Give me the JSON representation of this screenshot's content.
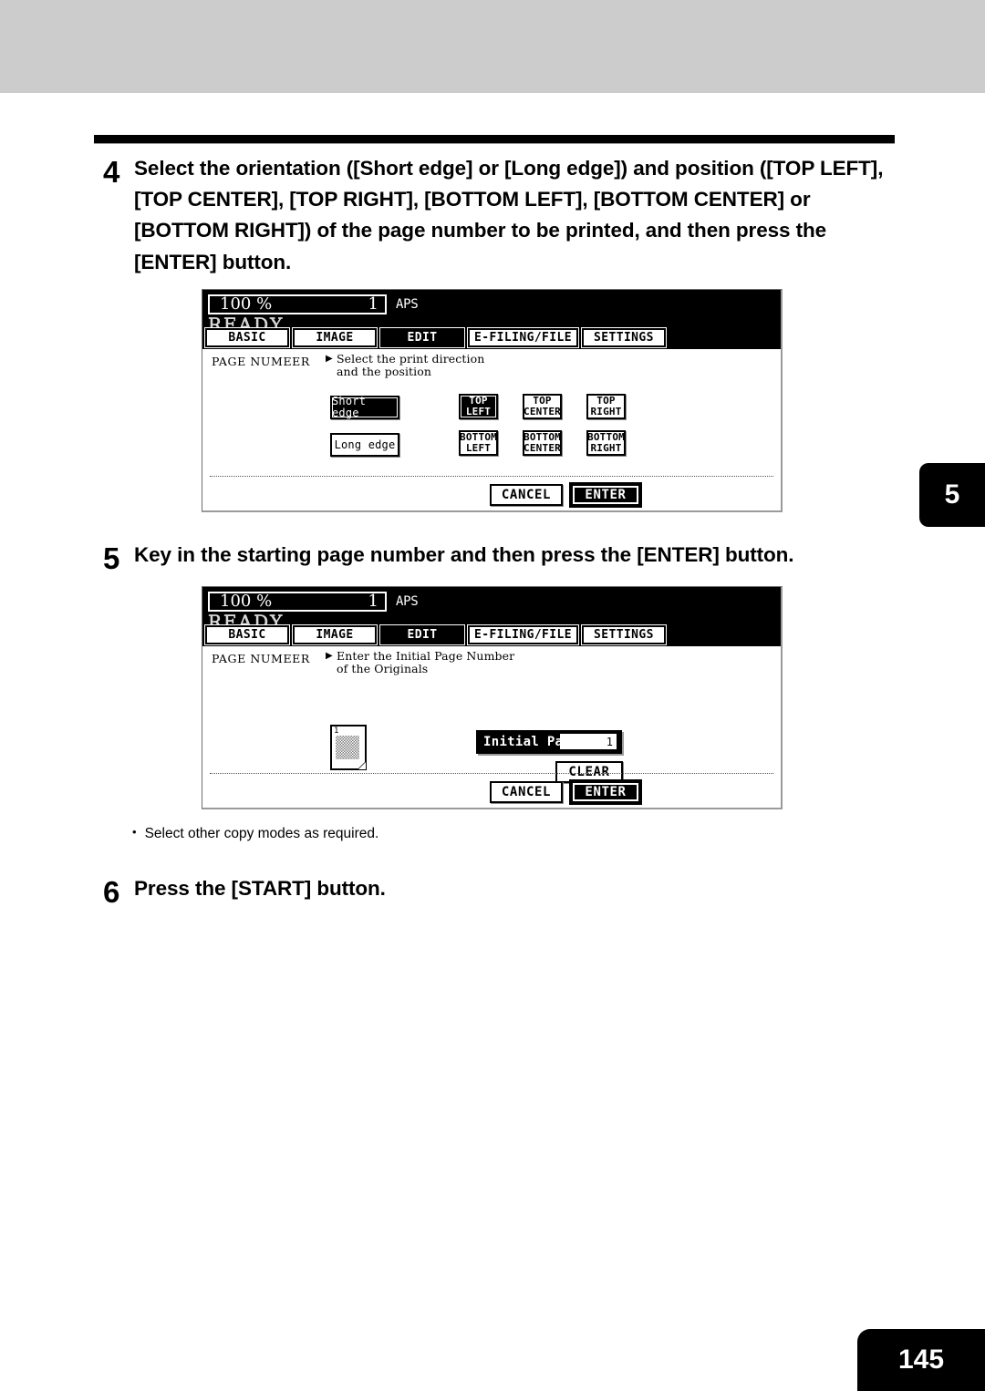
{
  "page": {
    "chapter_tab": "5",
    "page_number": "145"
  },
  "steps": [
    {
      "num": "4",
      "text": "Select the orientation ([Short edge] or [Long edge]) and position ([TOP LEFT], [TOP CENTER], [TOP RIGHT], [BOTTOM LEFT], [BOTTOM CENTER] or [BOTTOM RIGHT]) of the page number to be printed, and then press the [ENTER] button."
    },
    {
      "num": "5",
      "text": "Key in the starting page number and then press the [ENTER] button."
    },
    {
      "num": "6",
      "text": "Press the [START] button."
    }
  ],
  "note": {
    "bullet": "•",
    "text": "Select other copy modes as required."
  },
  "lcd_common": {
    "ratio": "100  %",
    "copies": "1",
    "aps": "APS",
    "status": "READY",
    "mode_label": "PAGE NUMEER",
    "tabs": [
      {
        "label": "BASIC",
        "selected": false
      },
      {
        "label": "IMAGE",
        "selected": false
      },
      {
        "label": "EDIT",
        "selected": true
      },
      {
        "label": "E-FILING/FILE",
        "selected": false
      },
      {
        "label": "SETTINGS",
        "selected": false
      }
    ],
    "cancel_label": "CANCEL",
    "enter_label": "ENTER",
    "arrow_icon": "▶"
  },
  "lcd1": {
    "hint_line1": "Select the print direction",
    "hint_line2": "and the position",
    "edge_options": [
      {
        "label": "Short edge",
        "selected": true
      },
      {
        "label": "Long edge",
        "selected": false
      }
    ],
    "positions": [
      {
        "line1": "TOP",
        "line2": "LEFT",
        "selected": true
      },
      {
        "line1": "TOP",
        "line2": "CENTER",
        "selected": false
      },
      {
        "line1": "TOP",
        "line2": "RIGHT",
        "selected": false
      },
      {
        "line1": "BOTTOM",
        "line2": "LEFT",
        "selected": false
      },
      {
        "line1": "BOTTOM",
        "line2": "CENTER",
        "selected": false
      },
      {
        "line1": "BOTTOM",
        "line2": "RIGHT",
        "selected": false
      }
    ]
  },
  "lcd2": {
    "hint_line1": "Enter the Initial Page Number",
    "hint_line2": "of the Originals",
    "page_icon_number": "1",
    "initial_page_label": "Initial Page :",
    "initial_page_value": "1",
    "clear_label": "CLEAR"
  },
  "colors": {
    "band": "#cccccc",
    "ink": "#000000",
    "paper": "#ffffff"
  }
}
